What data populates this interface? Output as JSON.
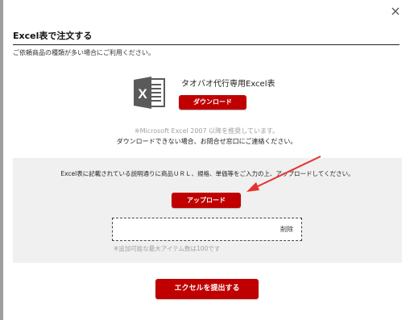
{
  "modal": {
    "close_glyph": "×",
    "title": "Excel表で注文する",
    "intro": "ご依頼商品の種類が多い場合にご利用ください。"
  },
  "template": {
    "icon": "excel-file-icon",
    "icon_letter": "X",
    "label": "タオバオ代行専用Excel表",
    "download_label": "ダウンロード"
  },
  "notes": {
    "recommend": "※Microsoft Excel 2007 以降を推奨しています。",
    "contact": "ダウンロードできない場合、お問合せ窓口にご連絡ください。"
  },
  "upload": {
    "instruction": "Excel表に記載されている説明通りに商品ＵＲＬ、規格、単価等をご入力の上、アップロードしてください。",
    "upload_label": "アップロード",
    "delete_label": "削除",
    "max_items_note": "※追加可能な最大アイテム数は100です"
  },
  "submit_label": "エクセルを提出する",
  "colors": {
    "accent_red": "#c00000",
    "excel_icon": "#5a5a5a",
    "panel_bg": "#f0f0f0",
    "annotation_arrow": "#e8312f"
  }
}
